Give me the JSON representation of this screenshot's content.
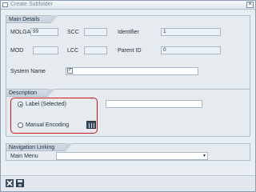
{
  "window": {
    "title": "Create Subfolder",
    "close_glyph": "×"
  },
  "main_details": {
    "title": "Main Details",
    "molga_label": "MOLGA",
    "molga_value": "99",
    "scc_label": "SCC",
    "scc_value": "",
    "identifier_label": "Identifier",
    "identifier_value": "1",
    "mod_label": "MOD",
    "mod_value": "",
    "lcc_label": "LCC",
    "lcc_value": "",
    "parent_id_label": "Parent ID",
    "parent_id_value": "0",
    "system_name_label": "System Name",
    "system_name_checked": true,
    "system_name_value": ""
  },
  "description": {
    "title": "Description",
    "label_option": "Label (Selected)",
    "label_selected": true,
    "label_value": "",
    "manual_option": "Manual Encoding",
    "manual_selected": false
  },
  "navigation": {
    "title": "Navigation Linking",
    "main_menu_label": "Main Menu",
    "main_menu_value": ""
  },
  "icons": {
    "close": "close-icon",
    "checkbox_check": "check-icon",
    "grid": "table-grid-icon",
    "dropdown": "chevron-down-icon",
    "cancel": "cancel-x-icon",
    "save": "save-floppy-icon"
  },
  "colors": {
    "highlight": "#d01515",
    "panel": "#e6ebf0",
    "header": "#c6d2de"
  }
}
